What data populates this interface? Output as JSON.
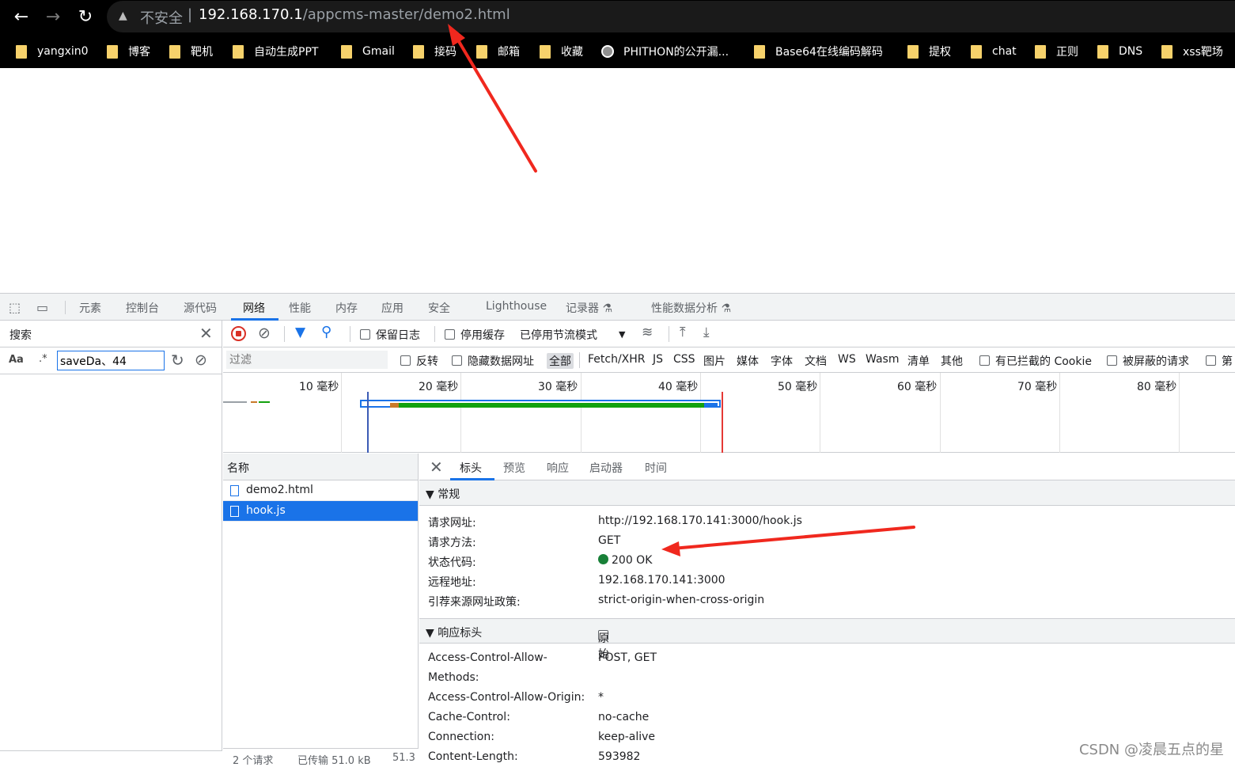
{
  "browser": {
    "nav": {
      "back": "←",
      "forward": "→",
      "reload": "↻"
    },
    "warning_icon": "▲",
    "insecure_label": "不安全",
    "url_separator": "|",
    "url_host": "192.168.170.1",
    "url_path": "/appcms-master/demo2.html",
    "bookmarks": [
      "yangxin0",
      "博客",
      "靶机",
      "自动生成PPT",
      "Gmail",
      "接码",
      "邮箱",
      "收藏",
      "PHITHON的公开漏...",
      "Base64在线编码解码",
      "提权",
      "chat",
      "正则",
      "DNS",
      "xss靶场"
    ]
  },
  "devtools": {
    "tabs": [
      "元素",
      "控制台",
      "源代码",
      "网络",
      "性能",
      "内存",
      "应用",
      "安全",
      "Lighthouse",
      "记录器 ⚗",
      "性能数据分析 ⚗"
    ],
    "active_tab": "网络",
    "search": {
      "title": "搜索",
      "close": "✕",
      "match_case": "Aa",
      "regex": ".*",
      "query": "saveDa、44",
      "refresh": "↻",
      "clear": "⊘"
    },
    "network": {
      "preserve_log": "保留日志",
      "disable_cache": "停用缓存",
      "throttling": "已停用节流模式",
      "filter_placeholder": "过滤",
      "invert": "反转",
      "hide_data_urls": "隐藏数据网址",
      "types": [
        "全部",
        "Fetch/XHR",
        "JS",
        "CSS",
        "图片",
        "媒体",
        "字体",
        "文档",
        "WS",
        "Wasm",
        "清单",
        "其他"
      ],
      "blocked_cookies": "有已拦截的 Cookie",
      "blocked_requests": "被屏蔽的请求",
      "third_party": "第",
      "ticks": [
        "10 毫秒",
        "20 毫秒",
        "30 毫秒",
        "40 毫秒",
        "50 毫秒",
        "60 毫秒",
        "70 毫秒",
        "80 毫秒"
      ],
      "name_header": "名称",
      "requests": [
        "demo2.html",
        "hook.js"
      ],
      "footer": {
        "count": "2 个请求",
        "transferred": "已传输 51.0 kB",
        "resources": "51.3"
      }
    },
    "detail": {
      "close": "✕",
      "tabs": [
        "标头",
        "预览",
        "响应",
        "启动器",
        "时间"
      ],
      "general_title": "▼ 常规",
      "general": [
        {
          "k": "请求网址:",
          "v": "http://192.168.170.141:3000/hook.js"
        },
        {
          "k": "请求方法:",
          "v": "GET"
        },
        {
          "k": "状态代码:",
          "v": "200 OK"
        },
        {
          "k": "远程地址:",
          "v": "192.168.170.141:3000"
        },
        {
          "k": "引荐来源网址政策:",
          "v": "strict-origin-when-cross-origin"
        }
      ],
      "response_title": "▼ 响应标头",
      "raw_label": "原始",
      "response": [
        {
          "k": "Access-Control-Allow-",
          "v": "POST, GET"
        },
        {
          "k": "Methods:",
          "v": ""
        },
        {
          "k": "Access-Control-Allow-Origin:",
          "v": "*"
        },
        {
          "k": "Cache-Control:",
          "v": "no-cache"
        },
        {
          "k": "Connection:",
          "v": "keep-alive"
        },
        {
          "k": "Content-Length:",
          "v": "593982"
        }
      ]
    }
  },
  "watermark": "CSDN @凌晨五点的星",
  "colors": {
    "accent": "#1a73e8",
    "status_ok": "#188038",
    "annotation_arrow": "#f0281e"
  }
}
